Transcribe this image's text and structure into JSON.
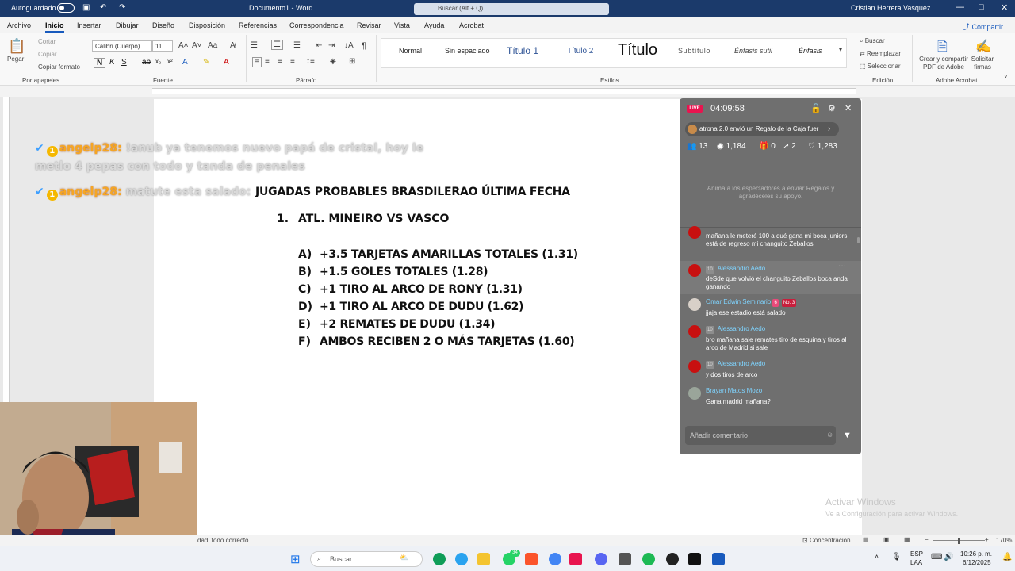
{
  "titlebar": {
    "autosave": "Autoguardado",
    "document_title": "Documento1 - Word",
    "search_placeholder": "Buscar (Alt + Q)",
    "user": "Cristian Herrera Vasquez"
  },
  "menu": {
    "tabs": [
      "Archivo",
      "Inicio",
      "Insertar",
      "Dibujar",
      "Diseño",
      "Disposición",
      "Referencias",
      "Correspondencia",
      "Revisar",
      "Vista",
      "Ayuda",
      "Acrobat"
    ],
    "active": "Inicio",
    "share": "Compartir"
  },
  "ribbon": {
    "clipboard": {
      "paste": "Pegar",
      "cut": "Cortar",
      "copy": "Copiar",
      "format_painter": "Copiar formato",
      "label": "Portapapeles"
    },
    "font": {
      "name": "Calibri (Cuerpo)",
      "size": "11",
      "label": "Fuente"
    },
    "paragraph": {
      "label": "Párrafo"
    },
    "styles": {
      "items": [
        "Normal",
        "Sin espaciado",
        "Título 1",
        "Título 2",
        "Título",
        "Subtítulo",
        "Énfasis sutil",
        "Énfasis"
      ],
      "label": "Estilos"
    },
    "editing": {
      "find": "Buscar",
      "replace": "Reemplazar",
      "select": "Seleccionar",
      "label": "Edición"
    },
    "acrobat": {
      "create": "Crear y compartir PDF de Adobe",
      "sign": "Solicitar firmas",
      "label": "Adobe Acrobat"
    }
  },
  "document": {
    "heading": "JUGADAS PROBABLES BRASDILERAO ÚLTIMA FECHA",
    "match_number": "1.",
    "match": "ATL. MINEIRO VS VASCO",
    "items": [
      {
        "letter": "A)",
        "text": " +3.5 TARJETAS AMARILLAS TOTALES (1.31)"
      },
      {
        "letter": "B)",
        "text": "+1.5 GOLES TOTALES (1.28)"
      },
      {
        "letter": "C)",
        "text": "+1 TIRO AL ARCO DE RONY (1.31)"
      },
      {
        "letter": "D)",
        "text": "+1 TIRO AL ARCO DE DUDU (1.62)"
      },
      {
        "letter": "E)",
        "text": "+2 REMATES DE DUDU (1.34)"
      },
      {
        "letter": "F)",
        "text": "AMBOS RECIBEN 2 O MÁS TARJETAS (1.60)"
      }
    ]
  },
  "overlay_chat": [
    {
      "user": "angelp28:",
      "message": "!anub ya tenemos nuevo papá de cristal, hoy le",
      "continuation": "metio 4 pepas con todo y tanda de penales"
    },
    {
      "user": "angelp28:",
      "message": "matute esta salado:"
    }
  ],
  "live": {
    "badge": "LIVE",
    "timer": "04:09:58",
    "gift_banner": "atrona 2.0 envió un Regalo de la Caja fuer",
    "stats": {
      "viewers_joined": "13",
      "views": "1,184",
      "gifts": "0",
      "shares": "2",
      "likes": "1,283"
    },
    "invite_text": "Anima a los espectadores a enviar Regalos y agradéceles su apoyo.",
    "messages": [
      {
        "user": "",
        "level": "",
        "text": "mañana le meteré 100 a qué gana mi boca juniors está de regreso mi changuito Zeballos"
      },
      {
        "user": "Alessandro Aedo",
        "level": "10",
        "text": "deSde que volvió el changuito Zeballos boca anda ganando"
      },
      {
        "user": "Omar Edwin Seminario",
        "level": "6",
        "rank": "No. 3",
        "text": "jjaja ese estadio está salado"
      },
      {
        "user": "Alessandro Aedo",
        "level": "10",
        "text": "bro mañana sale remates tiro de esquina y tiros al arco de Madrid si sale"
      },
      {
        "user": "Alessandro Aedo",
        "level": "10",
        "text": "y dos tiros de arco"
      },
      {
        "user": "Brayan Matos Mozo",
        "level": "",
        "text": "Gana madrid mañana?"
      }
    ],
    "comment_placeholder": "Añadir comentario"
  },
  "statusbar": {
    "accessibility": "dad: todo correcto",
    "focus": "Concentración",
    "zoom": "170%"
  },
  "watermark": {
    "title": "Activar Windows",
    "subtitle": "Ve a Configuración para activar Windows."
  },
  "taskbar": {
    "search": "Buscar",
    "badge_count": "34",
    "lang": "ESP",
    "region": "LAA",
    "time": "10:26 p. m.",
    "date": "6/12/2025"
  },
  "colors": {
    "word_blue": "#185abd",
    "titlebar": "#1b3a6b",
    "live_red": "#e8144f",
    "chat_user": "#7fd4ff"
  }
}
